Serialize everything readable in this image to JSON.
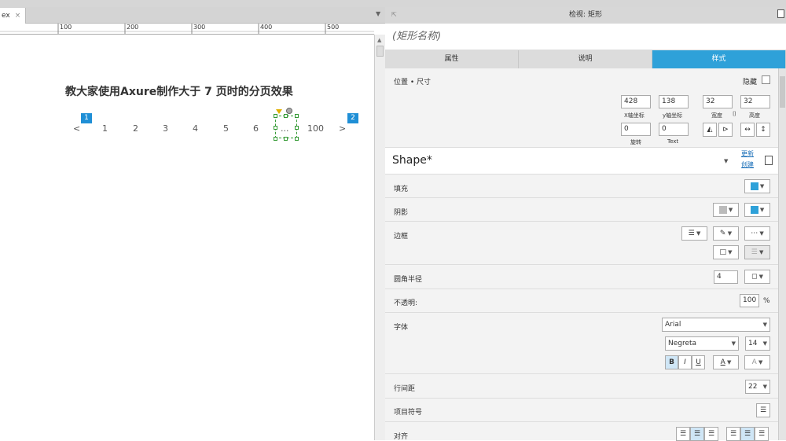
{
  "toolbar": {},
  "doc_tab": {
    "label": "ex",
    "close": "×"
  },
  "ruler": {
    "ticks": [
      "100",
      "200",
      "300",
      "400",
      "500"
    ]
  },
  "canvas": {
    "heading": "教大家使用Axure制作大于 7 页时的分页效果",
    "pager": {
      "prev": "<",
      "next": ">",
      "pages": [
        "1",
        "2",
        "3",
        "4",
        "5",
        "6",
        "...",
        "100"
      ],
      "badge_left": "1",
      "badge_right": "2"
    }
  },
  "panel": {
    "title": "检视: 矩形",
    "name_placeholder": "(矩形名称)",
    "tabs": [
      "属性",
      "说明",
      "样式"
    ],
    "position_size": {
      "label": "位置 • 尺寸",
      "hidden_label": "隐藏",
      "x": "428",
      "y": "138",
      "w": "32",
      "h": "32",
      "x_label": "X轴坐标",
      "y_label": "y轴坐标",
      "w_label": "宽度",
      "h_label": "高度",
      "rotate": "0",
      "text_rotate": "0",
      "rotate_label": "旋转",
      "text_label": "Text"
    },
    "style": {
      "name": "Shape*",
      "update": "更新",
      "create": "创建"
    },
    "fill": "填充",
    "shadow": "阴影",
    "border": "边框",
    "radius": {
      "label": "圆角半径",
      "value": "4"
    },
    "opacity": {
      "label": "不透明:",
      "value": "100",
      "unit": "%"
    },
    "font": {
      "label": "字体",
      "family": "Arial",
      "weight": "Negreta",
      "size": "14"
    },
    "line_height": {
      "label": "行间距",
      "value": "22"
    },
    "bullets": "项目符号",
    "align": "对齐",
    "colors": {
      "accent": "#2ea1d9",
      "badge": "#1f8fd6",
      "selection": "#393"
    }
  }
}
